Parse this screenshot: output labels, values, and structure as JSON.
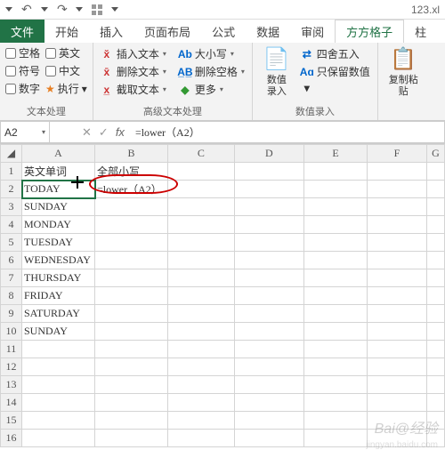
{
  "titlebar": {
    "filename": "123.xl"
  },
  "tabs": {
    "file": "文件",
    "t1": "开始",
    "t2": "插入",
    "t3": "页面布局",
    "t4": "公式",
    "t5": "数据",
    "t6": "审阅",
    "active": "方方格子",
    "last": "柱"
  },
  "ribbon": {
    "group1": {
      "label": "文本处理",
      "c1": "空格",
      "c2": "英文",
      "c3": "符号",
      "c4": "中文",
      "c5": "数字",
      "c6": "执行"
    },
    "group2": {
      "label": "高级文本处理",
      "b1": "插入文本",
      "b2": "删除文本",
      "b3": "截取文本",
      "b4": "大小写",
      "b5": "删除空格",
      "b6": "更多"
    },
    "group3": {
      "label": "数值录入",
      "big": "数值\n录入",
      "b1": "四舍五入",
      "b2": "只保留数值"
    },
    "group4": {
      "big": "复制粘\n贴"
    }
  },
  "formula": {
    "namebox": "A2",
    "content": "=lower（A2）"
  },
  "cells": {
    "A1": "英文单词",
    "B1": "全部小写",
    "B2": "=lower（A2）",
    "A2": "TODAY",
    "A3": "SUNDAY",
    "A4": "MONDAY",
    "A5": "TUESDAY",
    "A6": "WEDNESDAY",
    "A7": "THURSDAY",
    "A8": "FRIDAY",
    "A9": "SATURDAY",
    "A10": "SUNDAY"
  },
  "watermark": {
    "w1": "Bai@经验",
    "w2": "jingyan.baidu.com"
  },
  "chart_data": {
    "type": "table",
    "columns": [
      "英文单词",
      "全部小写"
    ],
    "rows": [
      [
        "TODAY",
        "=lower（A2）"
      ],
      [
        "SUNDAY",
        ""
      ],
      [
        "MONDAY",
        ""
      ],
      [
        "TUESDAY",
        ""
      ],
      [
        "WEDNESDAY",
        ""
      ],
      [
        "THURSDAY",
        ""
      ],
      [
        "FRIDAY",
        ""
      ],
      [
        "SATURDAY",
        ""
      ],
      [
        "SUNDAY",
        ""
      ]
    ],
    "formula_bar": "=lower（A2）",
    "selected_cell": "A2"
  }
}
